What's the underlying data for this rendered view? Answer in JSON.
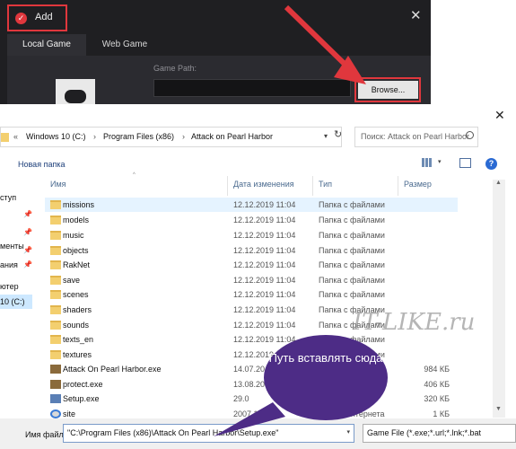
{
  "add_dialog": {
    "title": "Add",
    "tabs": [
      "Local Game",
      "Web Game"
    ],
    "game_path_label": "Game Path:",
    "game_path_value": "",
    "browse_label": "Browse...",
    "close_icon": "close-icon",
    "accent_color": "#e0373d"
  },
  "explorer": {
    "breadcrumb": [
      "Windows 10 (C:)",
      "Program Files (x86)",
      "Attack on Pearl Harbor"
    ],
    "search_placeholder": "Поиск: Attack on Pearl Harbor",
    "new_folder_label": "Новая папка",
    "nav_items": [
      "ступ",
      "менты",
      "ания",
      "ютер",
      "10 (C:)"
    ],
    "columns": [
      "Имя",
      "Дата изменения",
      "Тип",
      "Размер"
    ],
    "rows": [
      {
        "name": "missions",
        "date": "12.12.2019 11:04",
        "type": "Папка с файлами",
        "size": "",
        "icon": "folder"
      },
      {
        "name": "models",
        "date": "12.12.2019 11:04",
        "type": "Папка с файлами",
        "size": "",
        "icon": "folder"
      },
      {
        "name": "music",
        "date": "12.12.2019 11:04",
        "type": "Папка с файлами",
        "size": "",
        "icon": "folder"
      },
      {
        "name": "objects",
        "date": "12.12.2019 11:04",
        "type": "Папка с файлами",
        "size": "",
        "icon": "folder"
      },
      {
        "name": "RakNet",
        "date": "12.12.2019 11:04",
        "type": "Папка с файлами",
        "size": "",
        "icon": "folder"
      },
      {
        "name": "save",
        "date": "12.12.2019 11:04",
        "type": "Папка с файлами",
        "size": "",
        "icon": "folder"
      },
      {
        "name": "scenes",
        "date": "12.12.2019 11:04",
        "type": "Папка с файлами",
        "size": "",
        "icon": "folder"
      },
      {
        "name": "shaders",
        "date": "12.12.2019 11:04",
        "type": "Папка с файлами",
        "size": "",
        "icon": "folder"
      },
      {
        "name": "sounds",
        "date": "12.12.2019 11:04",
        "type": "Папка с файлами",
        "size": "",
        "icon": "folder"
      },
      {
        "name": "texts_en",
        "date": "12.12.2019 11:04",
        "type": "Папка с файлами",
        "size": "",
        "icon": "folder"
      },
      {
        "name": "textures",
        "date": "12.12.2019 11:04",
        "type": "Папка с файлами",
        "size": "",
        "icon": "folder"
      },
      {
        "name": "Attack On Pearl Harbor.exe",
        "date": "14.07.20",
        "type": "",
        "size": "984 КБ",
        "icon": "exe"
      },
      {
        "name": "protect.exe",
        "date": "13.08.20",
        "type": "",
        "size": "406 КБ",
        "icon": "exe"
      },
      {
        "name": "Setup.exe",
        "date": "29.0",
        "type": "",
        "size": "320 КБ",
        "icon": "setup"
      },
      {
        "name": "site",
        "date": "2007 11:59",
        "type": "Ярлык Интернета",
        "size": "1 КБ",
        "icon": "url"
      }
    ],
    "filename_label": "Имя файла:",
    "filename_value": "\"C:\\Program Files (x86)\\Attack On Pearl Harbor\\Setup.exe\"",
    "filetype_value": "Game File (*.exe;*.url;*.lnk;*.bat"
  },
  "watermark": "IT-LIKE.ru",
  "callout": {
    "text": "Путь вставлять сюда",
    "color": "#4d2c86"
  },
  "annotation_color": "#e0373d"
}
